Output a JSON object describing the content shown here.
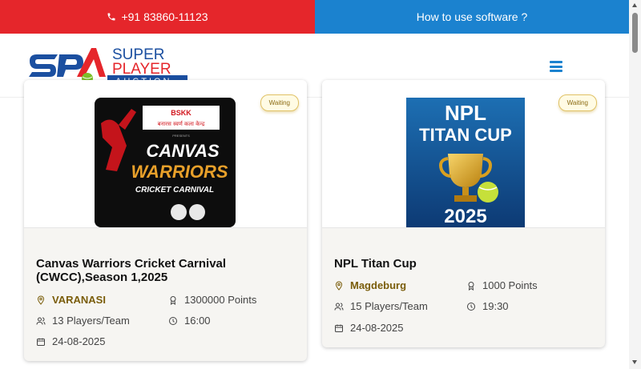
{
  "topbar": {
    "phone": "+91 83860-11123",
    "howto": "How to use software ?"
  },
  "brand": {
    "line1": "SUPER",
    "line2": "PLAYER",
    "line3": "AUCTION",
    "colors": {
      "blue": "#1b4fa0",
      "red": "#e5262b",
      "green": "#7cbf2a"
    }
  },
  "colors": {
    "phone_bar": "#e5262b",
    "howto_bar": "#1b82cf",
    "place_text": "#7a5d0a"
  },
  "cards": [
    {
      "status": "Waiting",
      "poster": {
        "logo": "BSKK",
        "org": "बनारस स्वर्ण कला केन्द्र",
        "presents": "PRESENTS",
        "line1": "CANVAS",
        "line2": "WARRIORS",
        "line3": "CRICKET CARNIVAL"
      },
      "title": "Canvas Warriors Cricket Carnival (CWCC),Season 1,2025",
      "location": "VARANASI",
      "points": "1300000 Points",
      "players": "13 Players/Team",
      "time": "16:00",
      "date": "24-08-2025"
    },
    {
      "status": "Waiting",
      "poster": {
        "line1": "NPL",
        "line2": "TITAN CUP",
        "year": "2025"
      },
      "title": "NPL Titan Cup",
      "location": "Magdeburg",
      "points": "1000 Points",
      "players": "15 Players/Team",
      "time": "19:30",
      "date": "24-08-2025"
    }
  ]
}
